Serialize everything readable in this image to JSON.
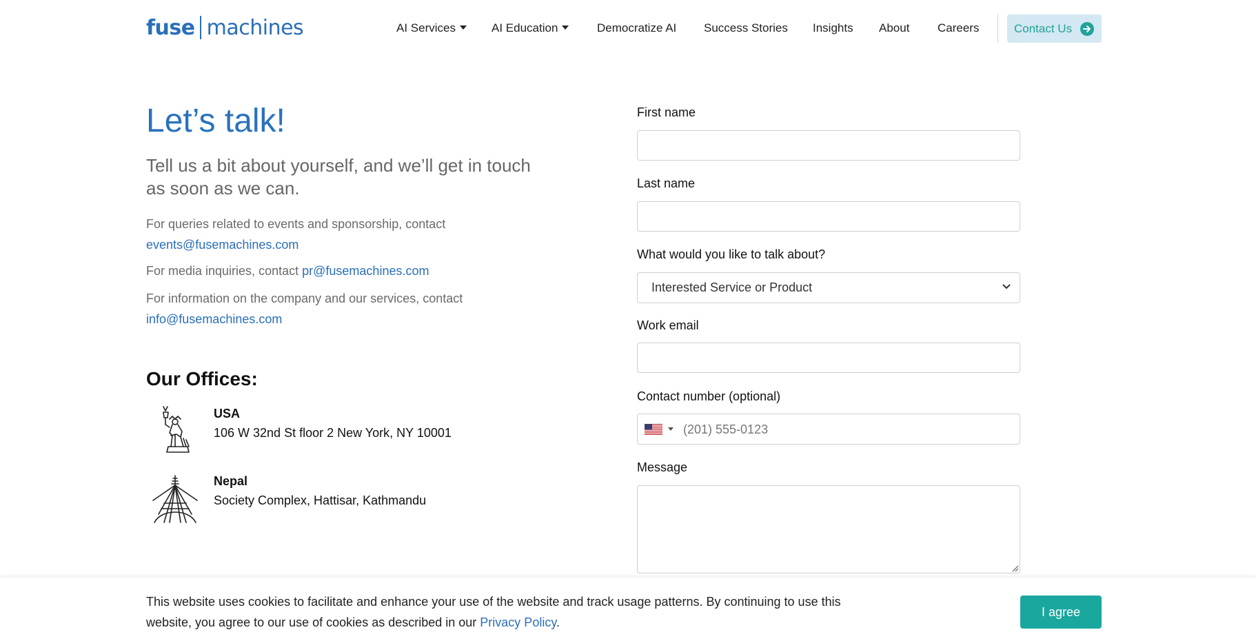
{
  "brand": {
    "logo_part1": "fuse",
    "logo_part2": "machines",
    "color": "#2a6fb8"
  },
  "nav": {
    "items": [
      {
        "label": "AI Services",
        "dropdown": true
      },
      {
        "label": "AI Education",
        "dropdown": true
      },
      {
        "label": "Democratize AI",
        "dropdown": false
      },
      {
        "label": "Success Stories",
        "dropdown": false
      },
      {
        "label": "Insights",
        "dropdown": false
      },
      {
        "label": "About",
        "dropdown": false
      },
      {
        "label": "Careers",
        "dropdown": false
      }
    ],
    "cta": {
      "label": "Contact Us",
      "icon": "arrow-right-circle-icon",
      "bg_color": "#d3e8f2",
      "accent_color": "#1fa29b"
    }
  },
  "intro": {
    "headline": "Let’s talk!",
    "subheadline": "Tell us a bit about yourself, and we’ll get in touch as soon as we can.",
    "contacts": [
      {
        "text": "For queries related to events and sponsorship, contact",
        "email": "events@fusemachines.com"
      },
      {
        "text": "For media inquiries, contact",
        "email": "pr@fusemachines.com"
      },
      {
        "text": "For information on the company and our services, contact",
        "email": "info@fusemachines.com"
      }
    ]
  },
  "offices": {
    "title": "Our Offices:",
    "items": [
      {
        "name": "USA",
        "address": "106 W 32nd St floor 2 New York, NY 10001",
        "icon": "statue-of-liberty-icon"
      },
      {
        "name": "Nepal",
        "address": "Society Complex, Hattisar, Kathmandu",
        "icon": "stupa-icon"
      }
    ]
  },
  "form": {
    "first_name": {
      "label": "First name",
      "value": "",
      "placeholder": ""
    },
    "last_name": {
      "label": "Last name",
      "value": "",
      "placeholder": ""
    },
    "topic": {
      "label": "What would you like to talk about?",
      "selected": "Interested Service or Product"
    },
    "work_email": {
      "label": "Work email",
      "value": "",
      "placeholder": ""
    },
    "contact_number": {
      "label": "Contact number (optional)",
      "country_flag": "us-flag-icon",
      "placeholder": "(201) 555-0123",
      "value": ""
    },
    "message": {
      "label": "Message",
      "value": "",
      "placeholder": ""
    }
  },
  "cookie": {
    "text": "This website uses cookies to facilitate and enhance your use of the website and track usage patterns. By continuing to use this website, you agree to our use of cookies as described in our",
    "link_label": "Privacy Policy",
    "suffix": ".",
    "button_label": "I agree",
    "button_color": "#1aa79e"
  }
}
